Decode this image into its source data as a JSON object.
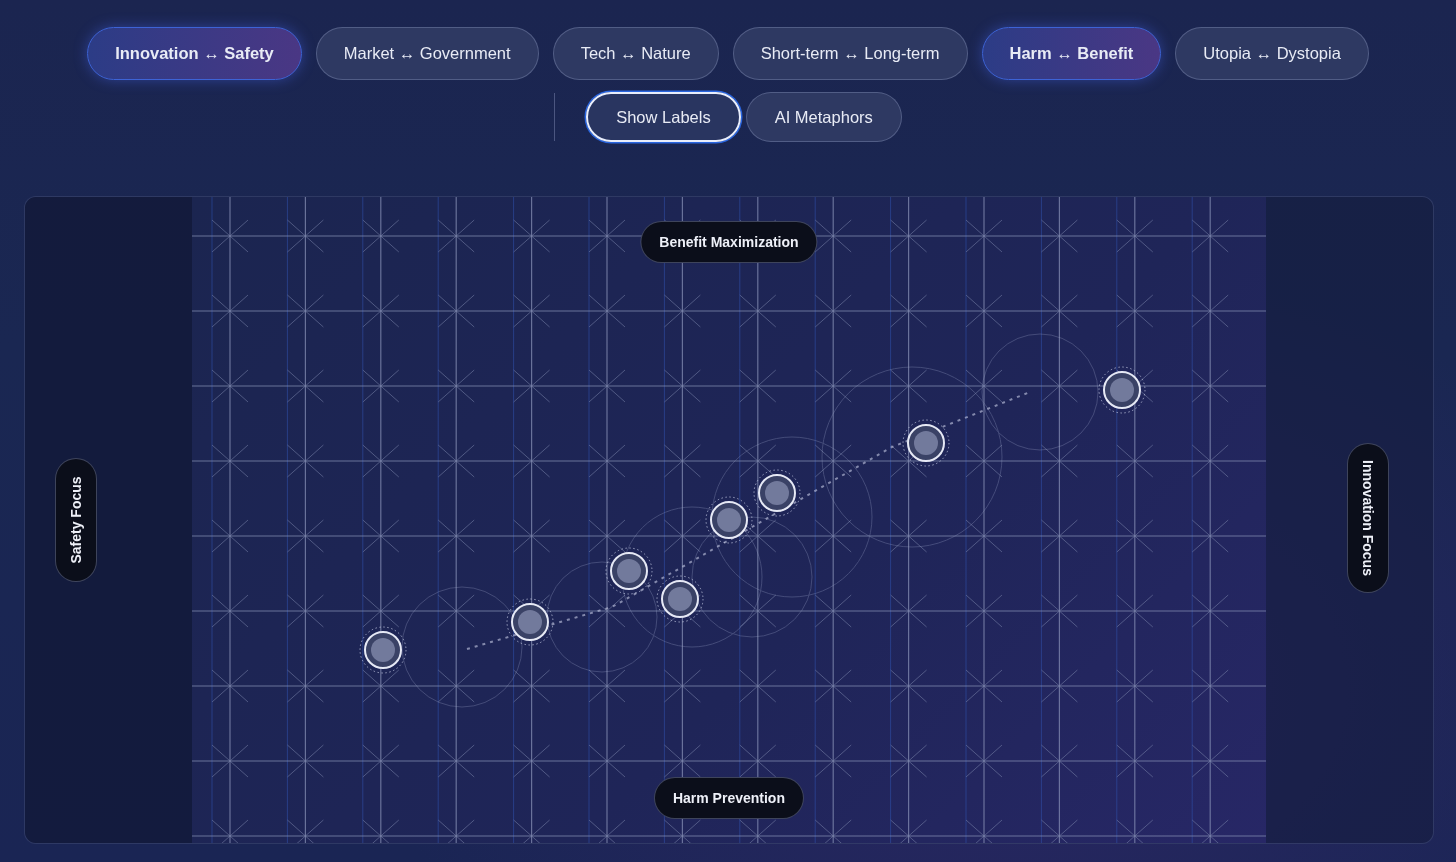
{
  "axis_buttons": [
    {
      "label": "Innovation ↔ Safety",
      "selected": true
    },
    {
      "label": "Market ↔ Government",
      "selected": false
    },
    {
      "label": "Tech ↔ Nature",
      "selected": false
    },
    {
      "label": "Short-term ↔ Long-term",
      "selected": false
    },
    {
      "label": "Harm ↔ Benefit",
      "selected": true
    },
    {
      "label": "Utopia ↔ Dystopia",
      "selected": false
    }
  ],
  "toggles": [
    {
      "label": "Show Labels",
      "selected": true
    },
    {
      "label": "AI Metaphors",
      "selected": false
    }
  ],
  "map": {
    "top_label": "Benefit Maximization",
    "bottom_label": "Harm Prevention",
    "left_label": "Safety Focus",
    "right_label": "Innovation Focus"
  }
}
